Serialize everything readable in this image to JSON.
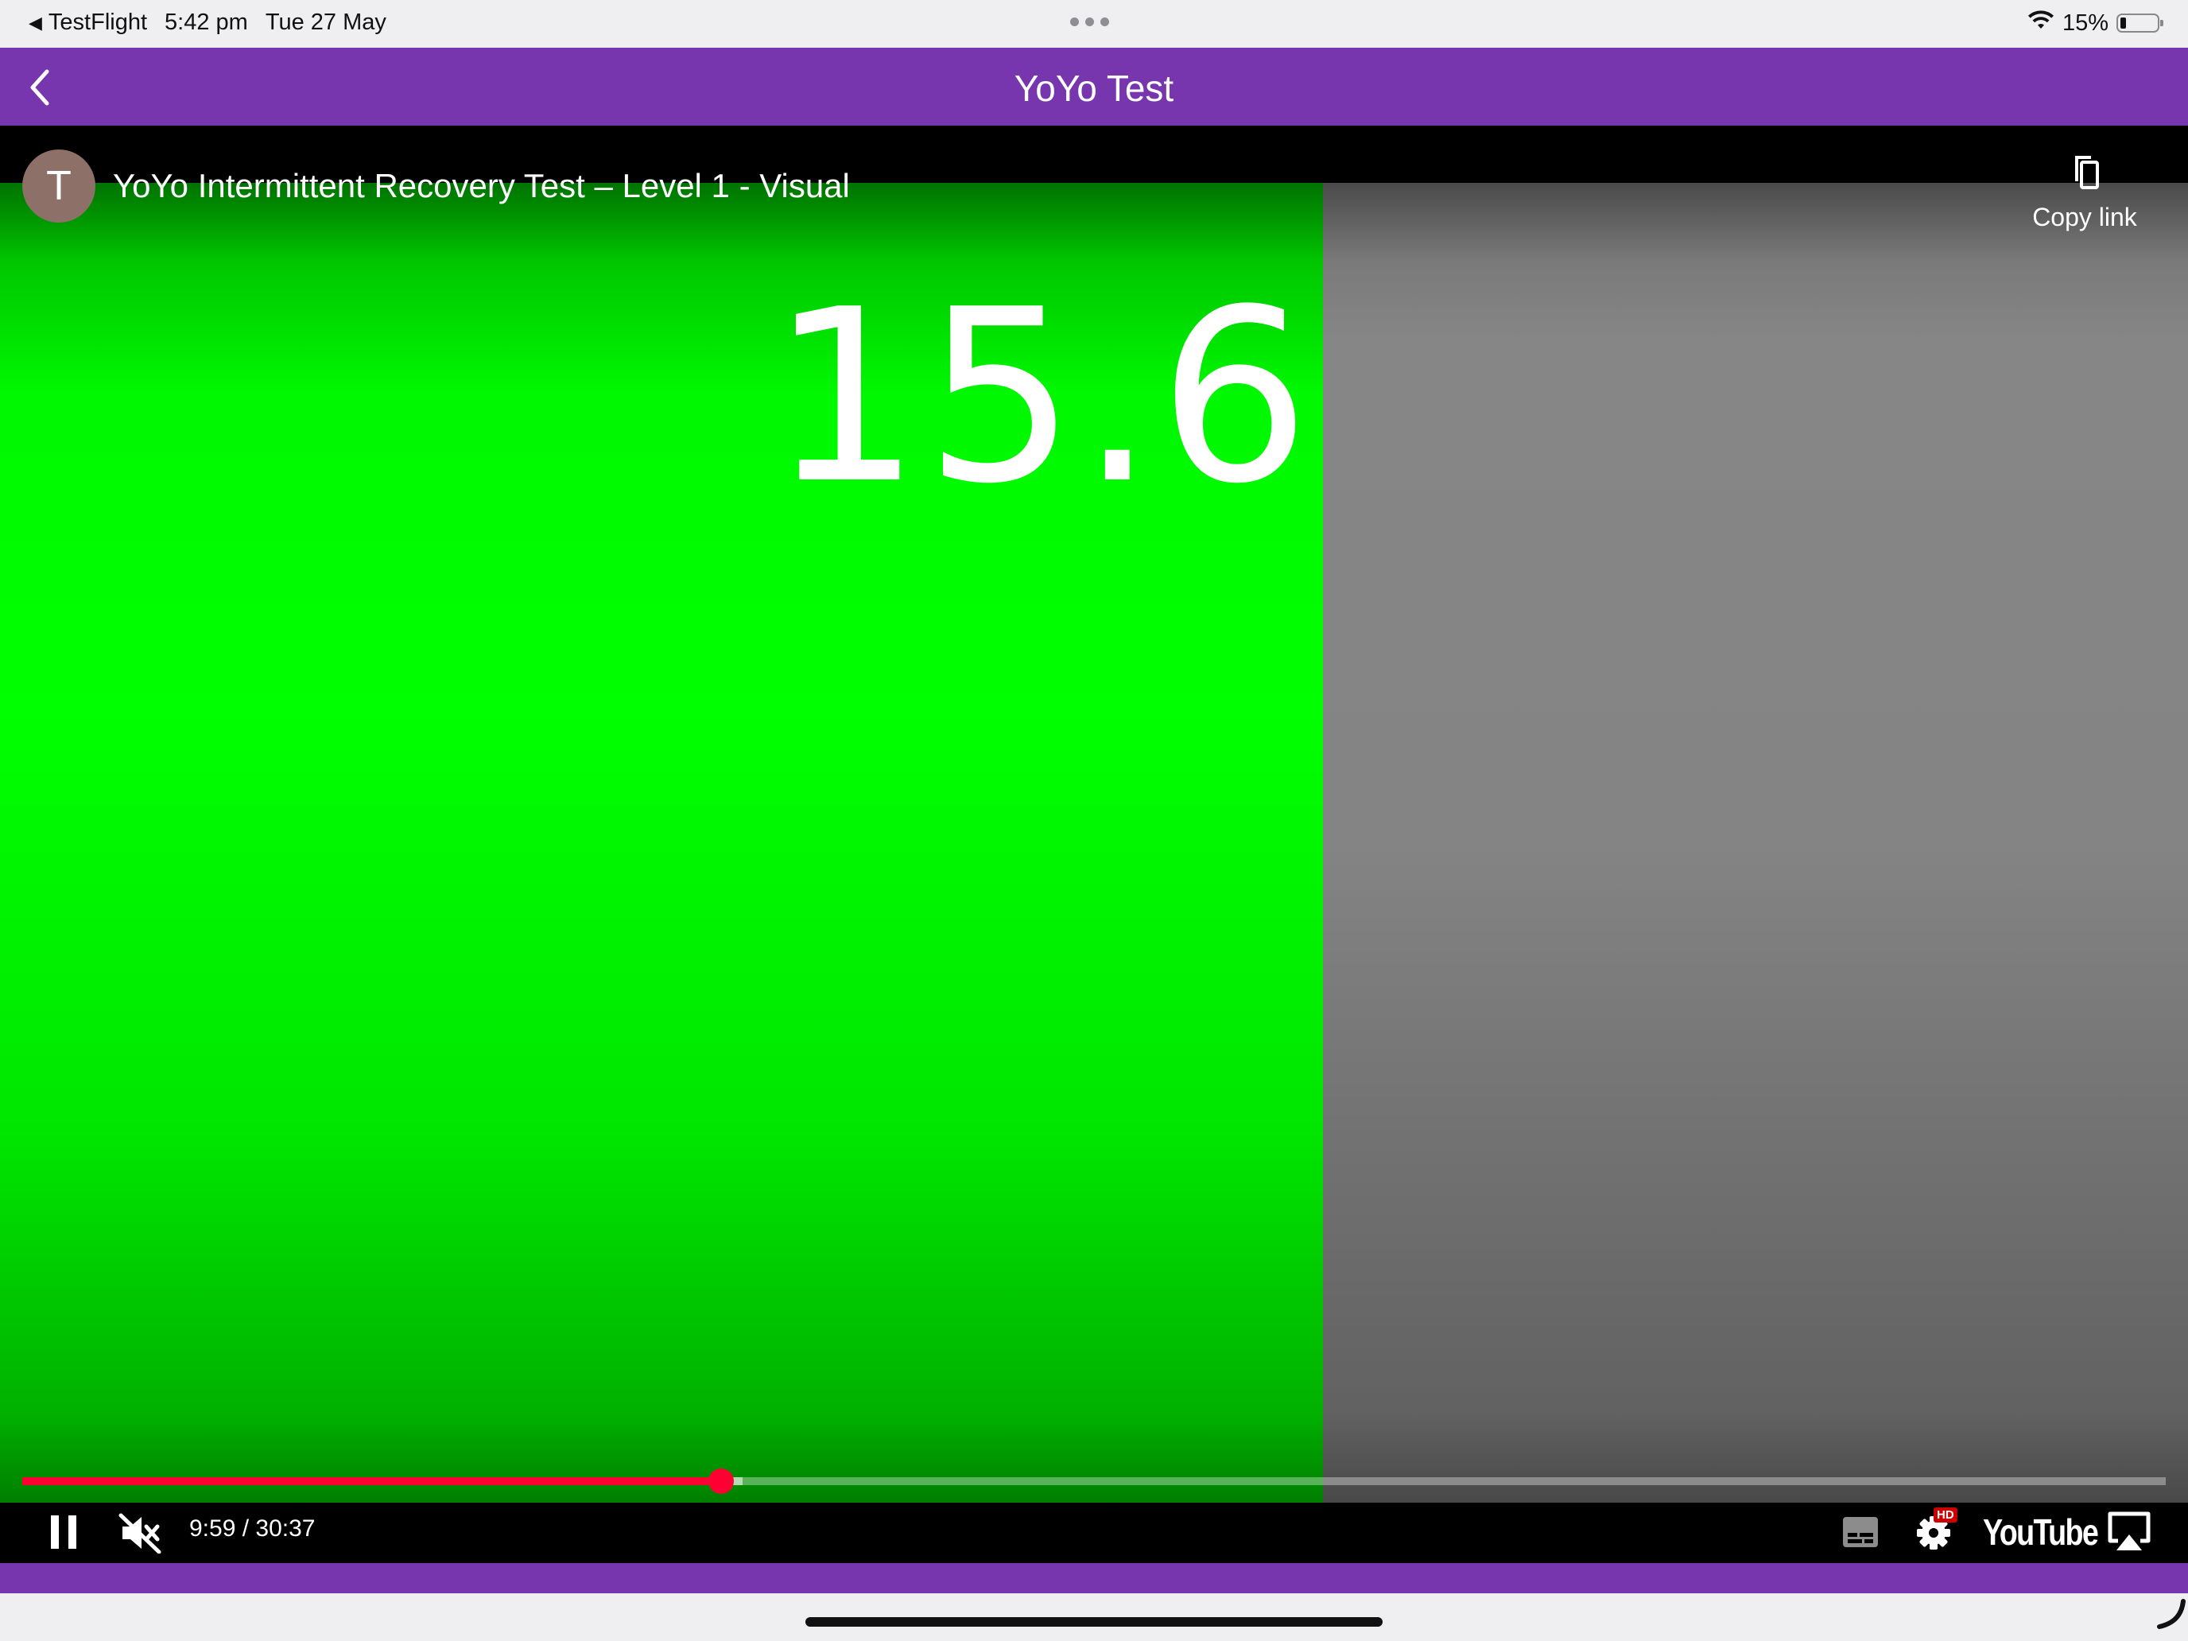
{
  "status_bar": {
    "back_app": "TestFlight",
    "time": "5:42 pm",
    "date": "Tue 27 May",
    "battery": "15%",
    "battery_level": 0.15
  },
  "app_bar": {
    "title": "YoYo Test",
    "back_icon": "chevron-left-icon"
  },
  "player": {
    "channel_initial": "T",
    "video_title": "YoYo Intermittent Recovery Test – Level 1 - Visual",
    "copy_link_label": "Copy link",
    "screen_number": "15.6",
    "time_display": "9:59 / 30:37",
    "elapsed": "9:59",
    "duration": "30:37",
    "progress": 0.326,
    "buffered": 0.336,
    "hd_badge": "HD",
    "youtube_label": "YouTube",
    "colors": {
      "green": "#00ff00",
      "gray": "#848484",
      "progress": "#ff0033"
    }
  },
  "theme": {
    "accent": "#7836ae"
  }
}
